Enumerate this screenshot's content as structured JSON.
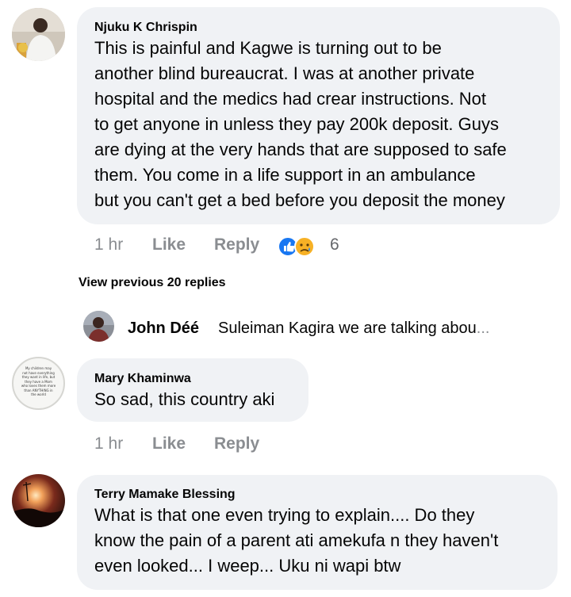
{
  "comments": [
    {
      "author": "Njuku K Chrispin",
      "lines": [
        "This is painful and Kagwe is turning out to be",
        "another blind bureaucrat. I was at another private",
        "hospital and the medics had crear instructions. Not",
        "to get anyone in unless they pay 200k deposit. Guys",
        "are dying at the very hands that are supposed to safe",
        "them. You come in a life support in an ambulance",
        "but you can't get a bed before you deposit the money"
      ],
      "time": "1 hr",
      "like_label": "Like",
      "reply_label": "Reply",
      "reaction_count": "6",
      "reaction_icons": [
        "like-reaction-icon",
        "sad-reaction-icon"
      ]
    },
    {
      "author": "Mary Khaminwa",
      "lines": [
        "So sad, this country aki"
      ],
      "time": "1 hr",
      "like_label": "Like",
      "reply_label": "Reply",
      "avatar_lines": [
        "My children may",
        "not have everything",
        "they want in life, but",
        "they have a Mom",
        "who loves them more",
        "than ANYTHING in",
        "the world"
      ]
    },
    {
      "author": "Terry Mamake Blessing",
      "lines": [
        "What is that one even trying to explain.... Do they",
        "know the pain of a parent ati  amekufa n they haven't",
        "even looked... I weep... Uku ni wapi btw"
      ]
    }
  ],
  "view_previous": "View previous 20 replies",
  "reply_preview": {
    "author": "John Déé",
    "text": "Suleiman Kagira we are talking abou",
    "ellipsis": "..."
  },
  "colors": {
    "bubble": "#f0f2f5",
    "meta": "#8a8d91",
    "like_blue": "#1877f2",
    "sad_yellow": "#f7b125"
  }
}
